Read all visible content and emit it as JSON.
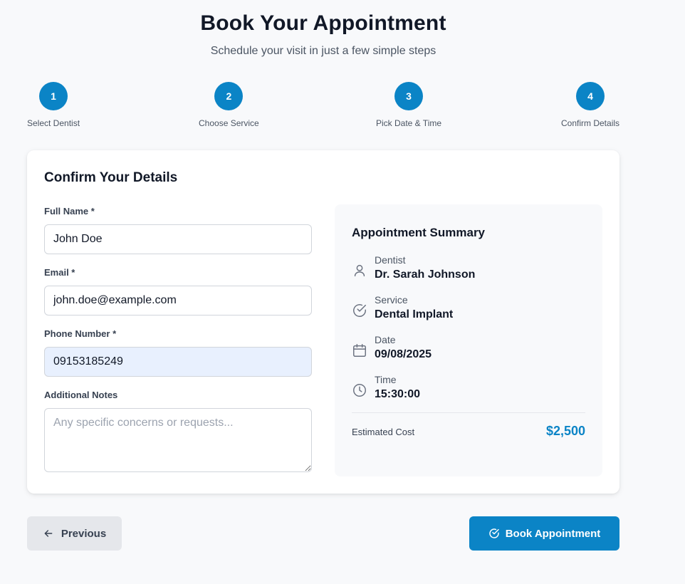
{
  "header": {
    "title": "Book Your Appointment",
    "subtitle": "Schedule your visit in just a few simple steps"
  },
  "steps": [
    {
      "number": "1",
      "label": "Select Dentist"
    },
    {
      "number": "2",
      "label": "Choose Service"
    },
    {
      "number": "3",
      "label": "Pick Date & Time"
    },
    {
      "number": "4",
      "label": "Confirm Details"
    }
  ],
  "form": {
    "title": "Confirm Your Details",
    "full_name": {
      "label": "Full Name *",
      "value": "John Doe"
    },
    "email": {
      "label": "Email *",
      "value": "john.doe@example.com"
    },
    "phone": {
      "label": "Phone Number *",
      "value": "09153185249"
    },
    "notes": {
      "label": "Additional Notes",
      "placeholder": "Any specific concerns or requests...",
      "value": ""
    }
  },
  "summary": {
    "title": "Appointment Summary",
    "items": [
      {
        "label": "Dentist",
        "value": "Dr. Sarah Johnson",
        "icon": "user-icon"
      },
      {
        "label": "Service",
        "value": "Dental Implant",
        "icon": "check-circle-icon"
      },
      {
        "label": "Date",
        "value": "09/08/2025",
        "icon": "calendar-icon"
      },
      {
        "label": "Time",
        "value": "15:30:00",
        "icon": "clock-icon"
      }
    ],
    "cost_label": "Estimated Cost",
    "cost_value": "$2,500"
  },
  "actions": {
    "previous_label": "Previous",
    "book_label": "Book Appointment"
  },
  "colors": {
    "accent": "#0b84c6",
    "background": "#f8f9fb",
    "autofill": "#e8f0fe"
  }
}
